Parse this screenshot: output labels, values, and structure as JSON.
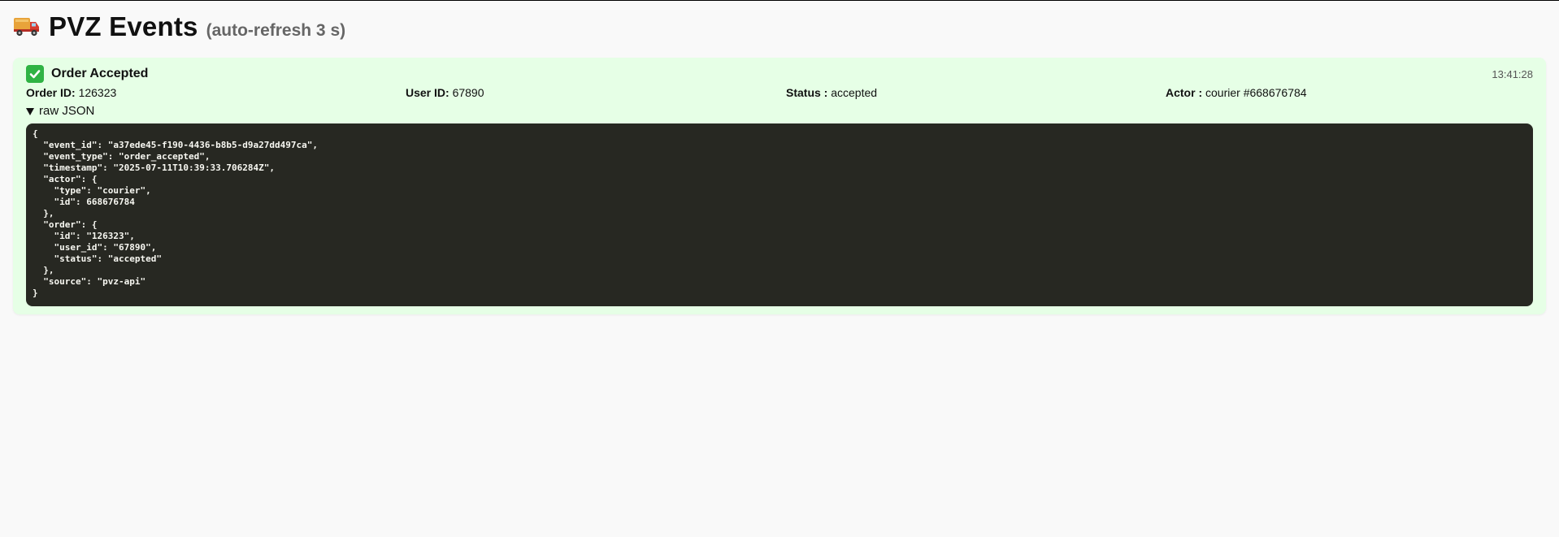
{
  "header": {
    "icon": "delivery-truck-icon",
    "title": "PVZ Events",
    "subtitle": "(auto-refresh 3 s)"
  },
  "event": {
    "status_icon": "checkmark-icon",
    "title": "Order Accepted",
    "time": "13:41:28",
    "fields": {
      "order_id_label": "Order ID:",
      "order_id_value": "126323",
      "user_id_label": "User ID:",
      "user_id_value": "67890",
      "status_label": "Status :",
      "status_value": "accepted",
      "actor_label": "Actor :",
      "actor_value": "courier #668676784"
    },
    "raw_toggle_label": "raw JSON",
    "raw_json": "{\n  \"event_id\": \"a37ede45-f190-4436-b8b5-d9a27dd497ca\",\n  \"event_type\": \"order_accepted\",\n  \"timestamp\": \"2025-07-11T10:39:33.706284Z\",\n  \"actor\": {\n    \"type\": \"courier\",\n    \"id\": 668676784\n  },\n  \"order\": {\n    \"id\": \"126323\",\n    \"user_id\": \"67890\",\n    \"status\": \"accepted\"\n  },\n  \"source\": \"pvz-api\"\n}"
  },
  "colors": {
    "card_bg": "#e6ffe6",
    "json_bg": "#272822",
    "page_bg": "#f9f9f9",
    "accent_green": "#2fb344"
  }
}
